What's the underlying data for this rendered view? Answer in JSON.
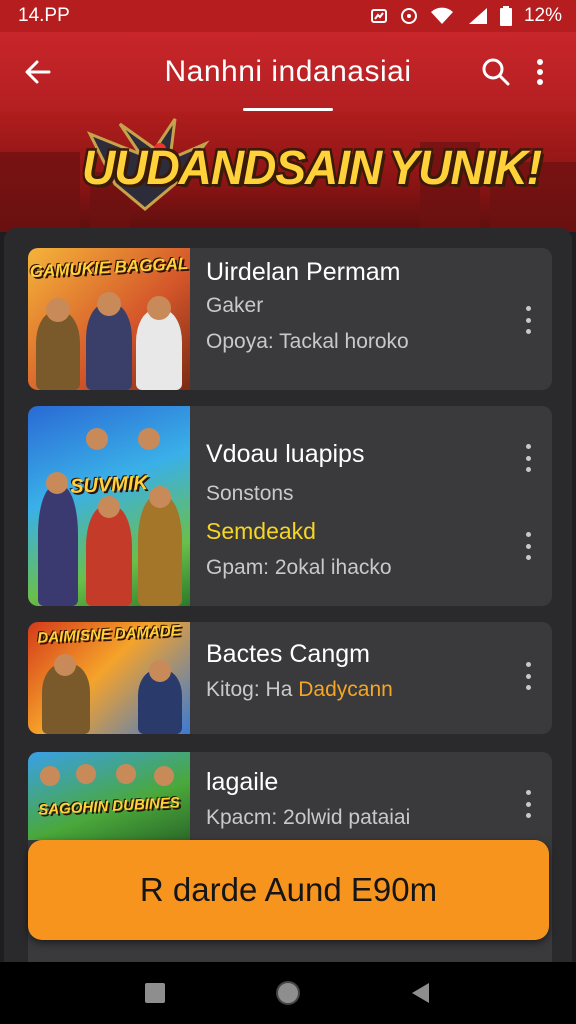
{
  "status_bar": {
    "time": "14.PP",
    "battery": "12%"
  },
  "app_bar": {
    "title": "Nanhni indanasiai"
  },
  "banner": {
    "text_part1": "UUDANDSAIN",
    "text_part2": "YUNIK!"
  },
  "games": [
    {
      "title": "Uirdelan Permam",
      "subtitle": "Gaker",
      "detail": "Opoya: Tackal horoko",
      "thumb_title": "GAMUKIE BAGGAL"
    },
    {
      "title": "Vdoau luapips",
      "subtitle": "Sonstons",
      "highlight": "Semdeakd",
      "detail": "Gpam: 2okal ihacko",
      "thumb_title": "SUVMIK"
    },
    {
      "title": "Bactes Cangm",
      "detail_prefix": "Kitog: Ha",
      "detail_highlight": "Dadycann",
      "thumb_title": "DAIMISNE DAMADE"
    },
    {
      "title": "lagaile",
      "detail": "Kpacm: 2olwid pataiai",
      "thumb_title": "SAGOHIN DUBINES"
    }
  ],
  "cta": {
    "label": "R darde Aund E90m"
  },
  "colors": {
    "primary": "#c8262a",
    "accent": "#f7941d",
    "highlight": "#f6d523",
    "card": "#3a3a3d"
  },
  "icons": [
    "back-arrow-icon",
    "search-icon",
    "more-vert-icon",
    "wifi-icon",
    "signal-icon",
    "battery-icon"
  ]
}
